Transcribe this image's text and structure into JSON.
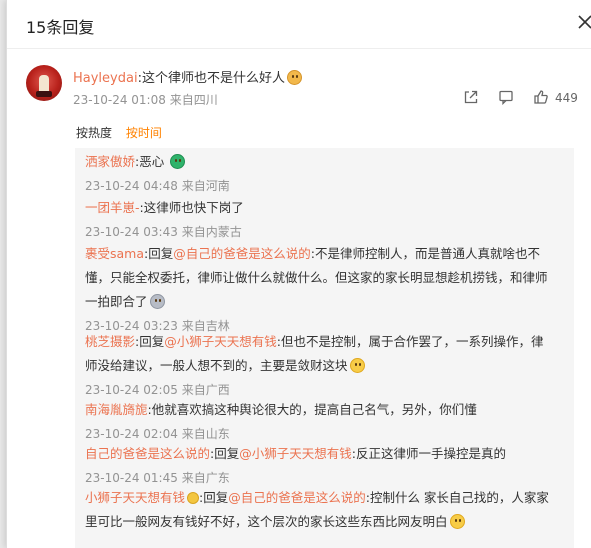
{
  "header": {
    "title": "15条回复"
  },
  "main_comment": {
    "user": "Hayleydai",
    "text": ":这个律师也不是什么好人",
    "time": "23-10-24 01:08",
    "location": "来自四川",
    "like_count": "449"
  },
  "sort": {
    "hot": "按热度",
    "time": "按时间"
  },
  "replies": [
    {
      "user": "洒家傲娇",
      "text": ":恶心",
      "time": "23-10-24 04:48",
      "location": "来自河南"
    },
    {
      "user": "一团羊崽-",
      "text": ":这律师也快下岗了",
      "time": "23-10-24 03:43",
      "location": "来自内蒙古"
    },
    {
      "user": "裹受sama",
      "reply_prefix": ":回复",
      "mention": "@自己的爸爸是这么说的",
      "text_line1": ":不是律师控制人，而是普通人真就啥也不",
      "text_line2": "懂，只能全权委托，律师让做什么就做什么。但这家的家长明显想趁机捞钱，和律师",
      "text_line3": "一拍即合了",
      "time": "23-10-24 03:23",
      "location": "来自吉林"
    },
    {
      "user": "桃芝摄影",
      "reply_prefix": ":回复",
      "mention": "@小狮子天天想有钱",
      "text_line1": ":但也不是控制，属于合作罢了，一系列操作，律",
      "text_line2": "师没给建议，一般人想不到的，主要是敛财这块",
      "time": "23-10-24 02:05",
      "location": "来自广西"
    },
    {
      "user": "南海胤旖旎",
      "text": ":他就喜欢搞这种舆论很大的，提高自己名气，另外，你们懂",
      "time": "23-10-24 02:04",
      "location": "来自山东"
    },
    {
      "user": "自己的爸爸是这么说的",
      "reply_prefix": ":回复",
      "mention": "@小狮子天天想有钱",
      "text": ":反正这律师一手操控是真的",
      "time": "23-10-24 01:45",
      "location": "来自广东"
    },
    {
      "user": "小狮子天天想有钱",
      "reply_prefix": ":回复",
      "mention": "@自己的爸爸是这么说的",
      "text_line1": ":控制什么 家长自己找的，人家家",
      "text_line2": "里可比一般网友有钱好不好，这个层次的家长这些东西比网友明白"
    }
  ]
}
